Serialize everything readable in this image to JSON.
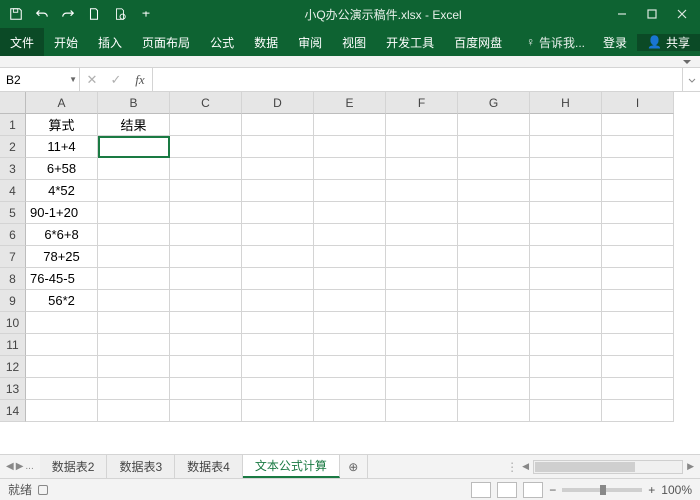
{
  "title": "小Q办公演示稿件.xlsx - Excel",
  "ribbon": {
    "file": "文件",
    "tabs": [
      "开始",
      "插入",
      "页面布局",
      "公式",
      "数据",
      "审阅",
      "视图",
      "开发工具",
      "百度网盘"
    ],
    "tell": "告诉我...",
    "login": "登录",
    "share": "共享"
  },
  "namebox": "B2",
  "formula": "",
  "cols": [
    "A",
    "B",
    "C",
    "D",
    "E",
    "F",
    "G",
    "H",
    "I"
  ],
  "rows": [
    "1",
    "2",
    "3",
    "4",
    "5",
    "6",
    "7",
    "8",
    "9",
    "10",
    "11",
    "12",
    "13",
    "14"
  ],
  "cells": {
    "A1": "算式",
    "B1": "结果",
    "A2": "11+4",
    "A3": "6+58",
    "A4": "4*52",
    "A5": "90-1+20",
    "A6": "6*6+8",
    "A7": "78+25",
    "A8": "76-45-5",
    "A9": "56*2"
  },
  "sheets": {
    "hidden": "...",
    "tabs": [
      "数据表2",
      "数据表3",
      "数据表4",
      "文本公式计算"
    ],
    "active": 3
  },
  "status": {
    "ready": "就绪",
    "zoom": "100%"
  }
}
